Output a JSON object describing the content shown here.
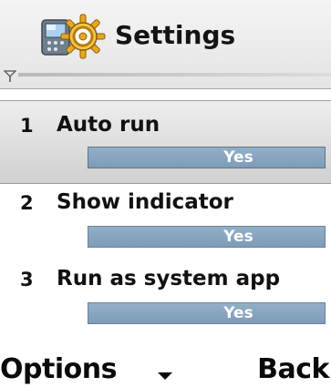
{
  "header": {
    "title": "Settings",
    "app_icon": "phone-with-gear-icon",
    "signal_icon": "signal-antenna-icon"
  },
  "settings": {
    "items": [
      {
        "number": "1",
        "label": "Auto run",
        "value": "Yes",
        "selected": true
      },
      {
        "number": "2",
        "label": "Show indicator",
        "value": "Yes",
        "selected": false
      },
      {
        "number": "3",
        "label": "Run as system app",
        "value": "Yes",
        "selected": false
      }
    ]
  },
  "softkeys": {
    "left": "Options",
    "right": "Back",
    "middle_icon": "arrow-down-icon"
  },
  "colors": {
    "value_field": "#7d9cb8",
    "selection_highlight": "#d0d0d0",
    "text": "#111111",
    "background": "#ffffff"
  }
}
